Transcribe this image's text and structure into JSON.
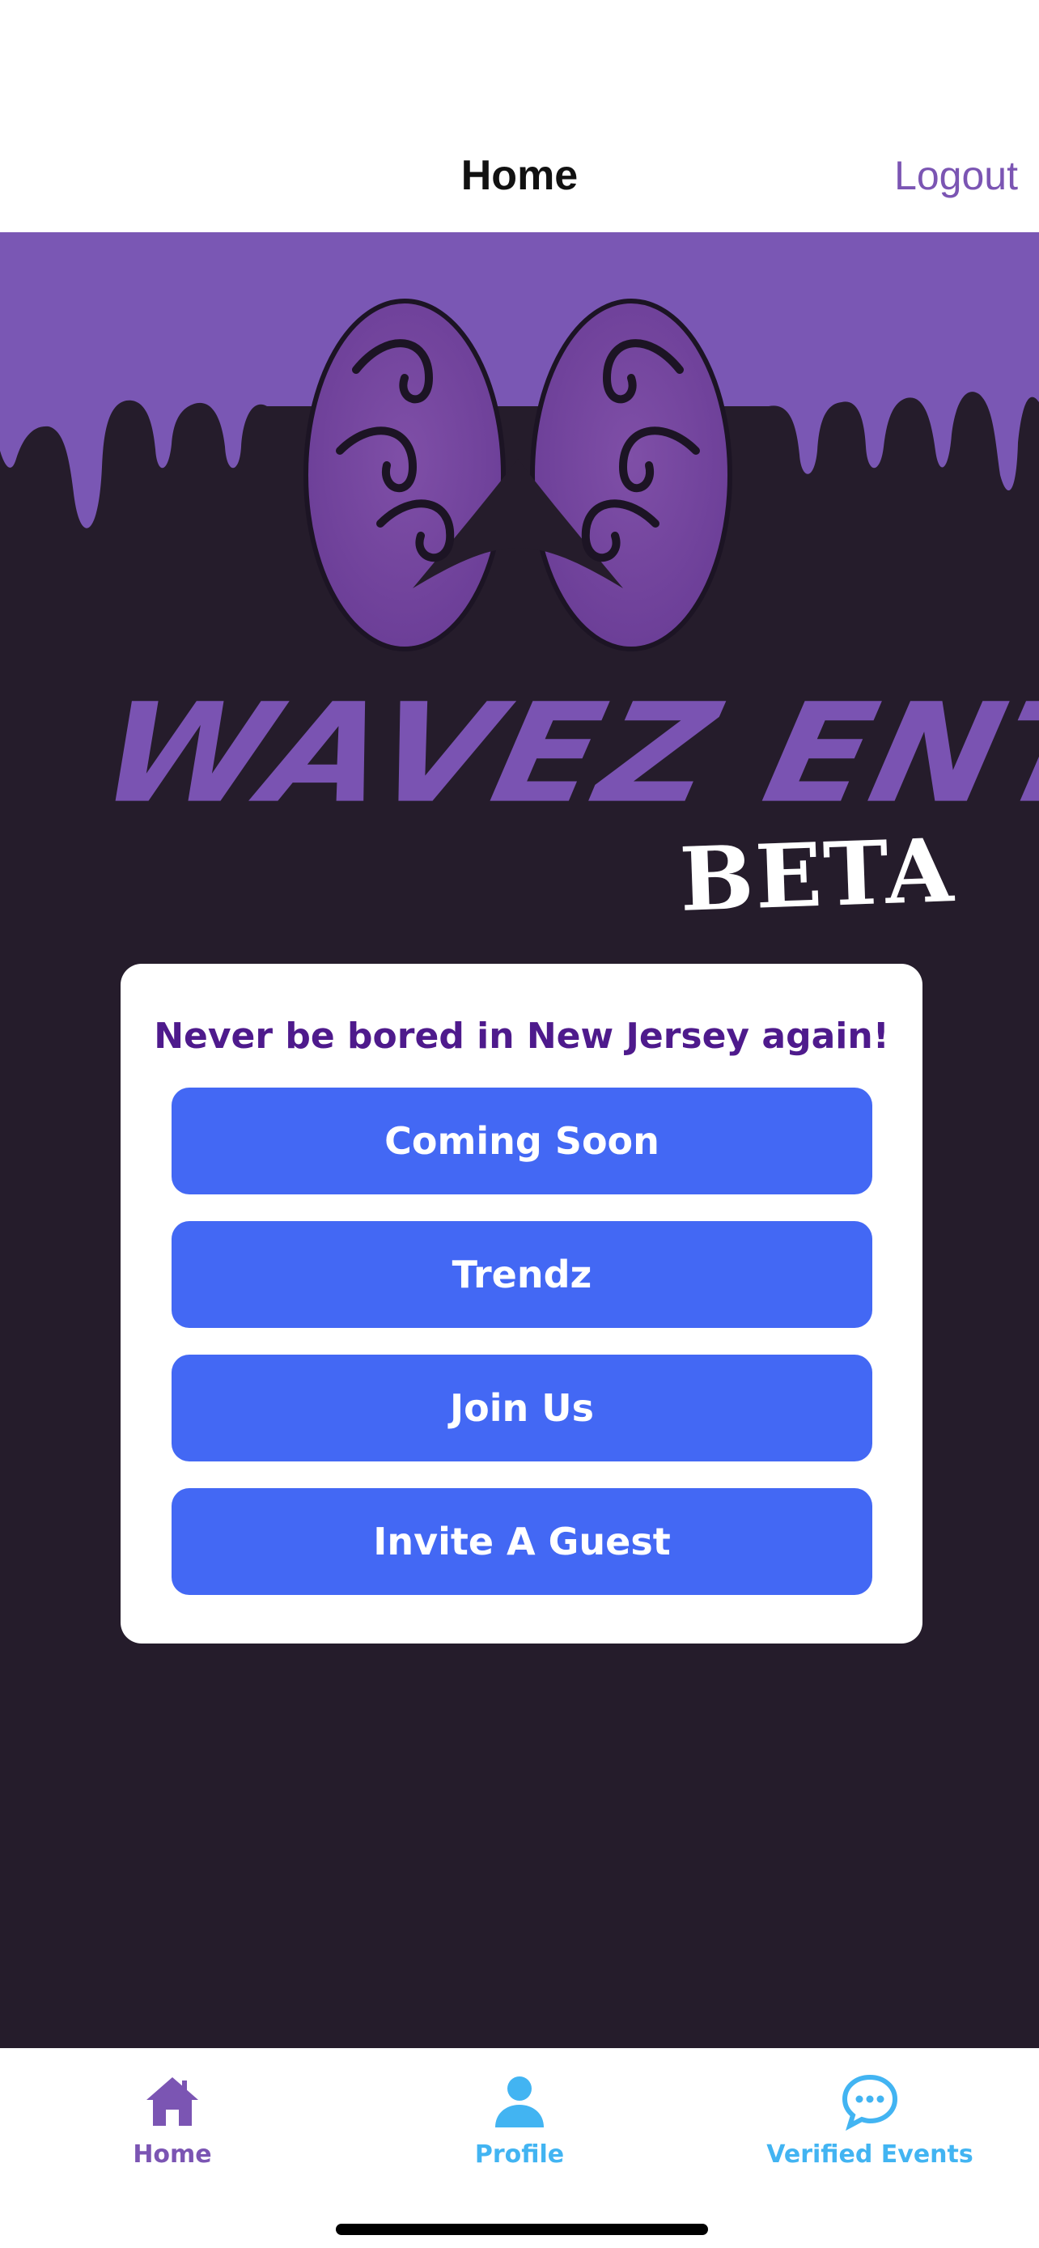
{
  "header": {
    "title": "Home",
    "logout_label": "Logout"
  },
  "brand": {
    "name": "WAVEZ ENT",
    "tag": "BETA"
  },
  "card": {
    "tagline": "Never be bored in New Jersey again!",
    "buttons": [
      {
        "label": "Coming Soon"
      },
      {
        "label": "Trendz"
      },
      {
        "label": "Join Us"
      },
      {
        "label": "Invite A Guest"
      }
    ]
  },
  "tabbar": {
    "items": [
      {
        "label": "Home",
        "icon": "home-icon",
        "active": true
      },
      {
        "label": "Profile",
        "icon": "person-icon",
        "active": false
      },
      {
        "label": "Verified Events",
        "icon": "chat-bubble-icon",
        "active": false
      }
    ]
  },
  "colors": {
    "accent_purple": "#7b55b3",
    "tagline_purple": "#4e1a8c",
    "button_blue": "#4368f4",
    "tab_inactive_blue": "#42b4f2",
    "background_dark": "#251c2b"
  }
}
